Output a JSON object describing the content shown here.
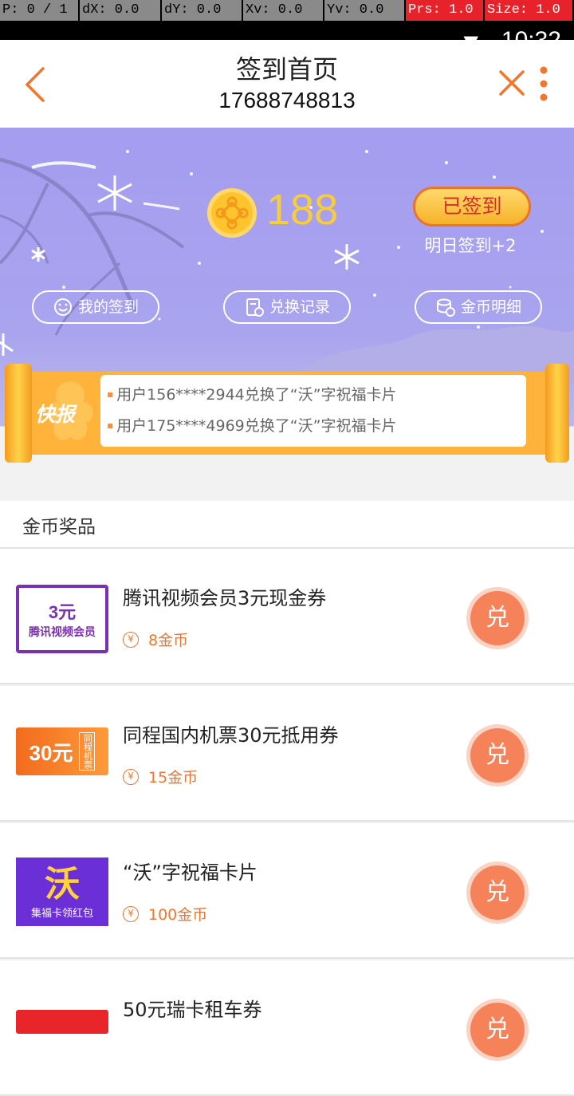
{
  "debug": {
    "cells": [
      "P: 0 / 1",
      "dX: 0.0",
      "dY: 0.0",
      "Xv: 0.0",
      "Yv: 0.0",
      "Prs: 1.0",
      "Size: 1.0"
    ],
    "time": "10:32"
  },
  "header": {
    "title": "签到首页",
    "phone": "17688748813"
  },
  "banner": {
    "coin_count": "188",
    "signed_label": "已签到",
    "tomorrow_label": "明日签到+2",
    "pills": {
      "my_signin": "我的签到",
      "exchange_record": "兑换记录",
      "coin_detail": "金币明细"
    }
  },
  "news": {
    "label": "快报",
    "items": [
      "用户156****2944兑换了“沃”字祝福卡片",
      "用户175****4969兑换了“沃”字祝福卡片"
    ]
  },
  "prizes": {
    "section_title": "金币奖品",
    "redeem_label": "兑",
    "items": [
      {
        "name": "腾讯视频会员3元现金券",
        "cost": "8金币",
        "thumb_main": "3元",
        "thumb_sub": "腾讯视频会员"
      },
      {
        "name": "同程国内机票30元抵用券",
        "cost": "15金币",
        "thumb_main": "30元",
        "thumb_sub": "同程机票"
      },
      {
        "name": "“沃”字祝福卡片",
        "cost": "100金币",
        "thumb_main": "沃",
        "thumb_sub": "集福卡领红包"
      },
      {
        "name": "50元瑞卡租车券",
        "cost": "",
        "thumb_main": "",
        "thumb_sub": ""
      }
    ]
  },
  "colors": {
    "accent": "#f4752c",
    "banner": "#a49df0",
    "coin": "#fdc42d"
  }
}
